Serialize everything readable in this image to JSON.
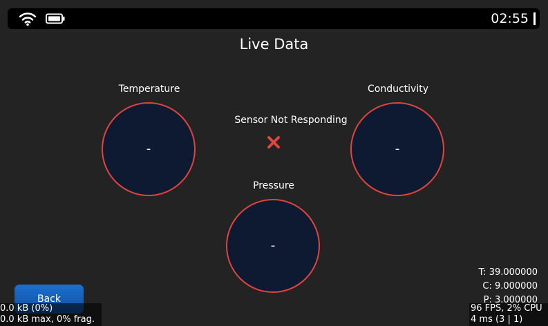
{
  "status_bar": {
    "time": "02:55"
  },
  "page": {
    "title": "Live Data"
  },
  "gauges": {
    "temperature": {
      "label": "Temperature",
      "value": "-"
    },
    "conductivity": {
      "label": "Conductivity",
      "value": "-"
    },
    "pressure": {
      "label": "Pressure",
      "value": "-"
    }
  },
  "sensor": {
    "status": "Sensor Not Responding",
    "status_icon": "error-x-icon",
    "status_color": "#e0443d"
  },
  "back_button": {
    "label": "Back"
  },
  "readings": {
    "temperature": "T: 39.000000",
    "conductivity": "C: 9.000000",
    "pressure": "P: 3.000000"
  },
  "memory_monitor": {
    "line1": "0.0 kB (0%)",
    "line2": "0.0 kB max, 0% frag."
  },
  "performance_monitor": {
    "line1": "96 FPS, 2% CPU",
    "line2": "4 ms (3 | 1)"
  },
  "colors": {
    "background": "#232323",
    "gauge_fill": "#0e1a31",
    "gauge_border": "#e0443d",
    "button": "#1d6fd0"
  }
}
